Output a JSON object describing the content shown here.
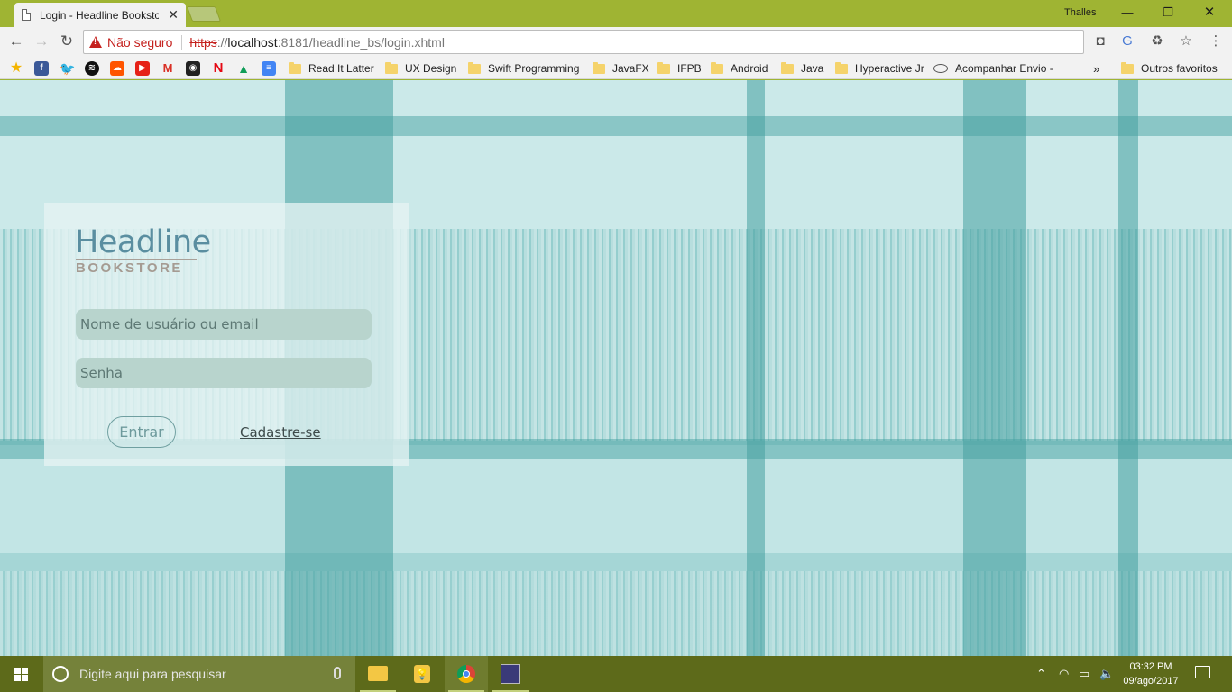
{
  "browser": {
    "tab_title": "Login - Headline Bookstc",
    "user": "Thalles",
    "security_label": "Não seguro",
    "url_scheme": "https",
    "url_separator": "://",
    "url_host": "localhost",
    "url_rest": ":8181/headline_bs/login.xhtml",
    "bookmarks": [
      {
        "label": "Read It Latter"
      },
      {
        "label": "UX Design"
      },
      {
        "label": "Swift Programming"
      },
      {
        "label": "JavaFX"
      },
      {
        "label": "IFPB"
      },
      {
        "label": "Android"
      },
      {
        "label": "Java"
      },
      {
        "label": "Hyperactive Jr"
      },
      {
        "label": "Acompanhar Envio -"
      },
      {
        "label": "Outros favoritos"
      }
    ],
    "bookmark_overflow": "»"
  },
  "page": {
    "logo_title": "Headline",
    "logo_subtitle": "BOOKSTORE",
    "username_placeholder": "Nome de usuário ou email",
    "password_placeholder": "Senha",
    "login_button": "Entrar",
    "signup_link": "Cadastre-se"
  },
  "taskbar": {
    "search_placeholder": "Digite aqui para pesquisar",
    "time": "03:32 PM",
    "date": "09/ago/2017"
  },
  "colors": {
    "chrome_frame": "#9fb433",
    "page_bg": "#a5d6d6",
    "logo_blue": "#5a8ea0",
    "logo_grey": "#a59b92",
    "taskbar": "#5d6a1a",
    "warning_red": "#c5221f"
  }
}
